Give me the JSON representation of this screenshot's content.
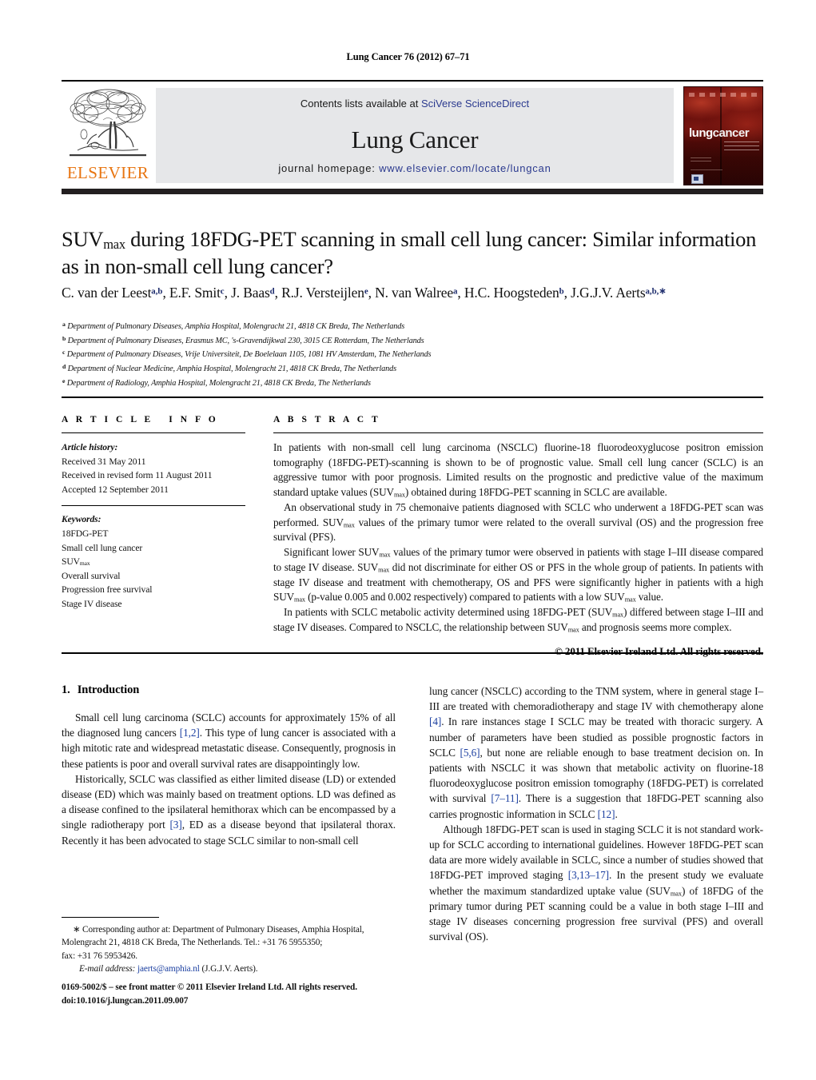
{
  "running_head": "Lung Cancer 76 (2012) 67–71",
  "masthead": {
    "contents_prefix": "Contents lists available at ",
    "contents_link": "SciVerse ScienceDirect",
    "journal_title": "Lung Cancer",
    "homepage_prefix": "journal homepage: ",
    "homepage_url": "www.elsevier.com/locate/lungcan",
    "publisher_wordmark": "ELSEVIER",
    "cover_title_part1": "lung",
    "cover_title_part2": "cancer",
    "link_color": "#2B3A8F",
    "banner_bg": "#E6E7E9",
    "elsevier_orange": "#E87511"
  },
  "title": {
    "line1_pre": "SUV",
    "line1_sub": "max",
    "line1_post": " during 18FDG-PET scanning in small cell lung cancer: Similar information",
    "line2": "as in non-small cell lung cancer?"
  },
  "authors": [
    {
      "name": "C. van der Leest",
      "sup": "a,b",
      "sep": ", "
    },
    {
      "name": "E.F. Smit",
      "sup": "c",
      "sep": ", "
    },
    {
      "name": "J. Baas",
      "sup": "d",
      "sep": ", "
    },
    {
      "name": "R.J. Versteijlen",
      "sup": "e",
      "sep": ", "
    },
    {
      "name": "N. van Walree",
      "sup": "a",
      "sep": ", "
    },
    {
      "name": "H.C. Hoogsteden",
      "sup": "b",
      "sep": ", "
    },
    {
      "name": "J.G.J.V. Aerts",
      "sup": "a,b,∗",
      "sep": ""
    }
  ],
  "affiliations": [
    {
      "marker": "a",
      "text": "Department of Pulmonary Diseases, Amphia Hospital, Molengracht 21, 4818 CK Breda, The Netherlands"
    },
    {
      "marker": "b",
      "text": "Department of Pulmonary Diseases, Erasmus MC, 's-Gravendijkwal 230, 3015 CE Rotterdam, The Netherlands"
    },
    {
      "marker": "c",
      "text": "Department of Pulmonary Diseases, Vrije Universiteit, De Boelelaan 1105, 1081 HV Amsterdam, The Netherlands"
    },
    {
      "marker": "d",
      "text": "Department of Nuclear Medicine, Amphia Hospital, Molengracht 21, 4818 CK Breda, The Netherlands"
    },
    {
      "marker": "e",
      "text": "Department of Radiology, Amphia Hospital, Molengracht 21, 4818 CK Breda, The Netherlands"
    }
  ],
  "article_info": {
    "heading": "ARTICLE INFO",
    "history_label": "Article history:",
    "history": [
      "Received 31 May 2011",
      "Received in revised form 11 August 2011",
      "Accepted 12 September 2011"
    ],
    "keywords_label": "Keywords:",
    "keywords": [
      "18FDG-PET",
      "Small cell lung cancer",
      "SUVmax",
      "Overall survival",
      "Progression free survival",
      "Stage IV disease"
    ]
  },
  "abstract": {
    "heading": "ABSTRACT",
    "paragraphs": [
      "In patients with non-small cell lung carcinoma (NSCLC) fluorine-18 fluorodeoxyglucose positron emission tomography (18FDG-PET)-scanning is shown to be of prognostic value. Small cell lung cancer (SCLC) is an aggressive tumor with poor prognosis. Limited results on the prognostic and predictive value of the maximum standard uptake values (SUVmax) obtained during 18FDG-PET scanning in SCLC are available.",
      "An observational study in 75 chemonaive patients diagnosed with SCLC who underwent a 18FDG-PET scan was performed. SUVmax values of the primary tumor were related to the overall survival (OS) and the progression free survival (PFS).",
      "Significant lower SUVmax values of the primary tumor were observed in patients with stage I–III disease compared to stage IV disease. SUVmax did not discriminate for either OS or PFS in the whole group of patients. In patients with stage IV disease and treatment with chemotherapy, OS and PFS were significantly higher in patients with a high SUVmax (p-value 0.005 and 0.002 respectively) compared to patients with a low SUVmax value.",
      "In patients with SCLC metabolic activity determined using 18FDG-PET (SUVmax) differed between stage I–III and stage IV diseases. Compared to NSCLC, the relationship between SUVmax and prognosis seems more complex."
    ],
    "copyright": "© 2011 Elsevier Ireland Ltd. All rights reserved."
  },
  "body": {
    "section_number": "1.",
    "section_title": "Introduction",
    "left_paragraphs": [
      "Small cell lung carcinoma (SCLC) accounts for approximately 15% of all the diagnosed lung cancers [1,2]. This type of lung cancer is associated with a high mitotic rate and widespread metastatic disease. Consequently, prognosis in these patients is poor and overall survival rates are disappointingly low.",
      "Historically, SCLC was classified as either limited disease (LD) or extended disease (ED) which was mainly based on treatment options. LD was defined as a disease confined to the ipsilateral hemithorax which can be encompassed by a single radiotherapy port [3], ED as a disease beyond that ipsilateral thorax. Recently it has been advocated to stage SCLC similar to non-small cell"
    ],
    "right_paragraphs": [
      "lung cancer (NSCLC) according to the TNM system, where in general stage I–III are treated with chemoradiotherapy and stage IV with chemotherapy alone [4]. In rare instances stage I SCLC may be treated with thoracic surgery. A number of parameters have been studied as possible prognostic factors in SCLC [5,6], but none are reliable enough to base treatment decision on. In patients with NSCLC it was shown that metabolic activity on fluorine-18 fluorodeoxyglucose positron emission tomography (18FDG-PET) is correlated with survival [7–11]. There is a suggestion that 18FDG-PET scanning also carries prognostic information in SCLC [12].",
      "Although 18FDG-PET scan is used in staging SCLC it is not standard work-up for SCLC according to international guidelines. However 18FDG-PET scan data are more widely available in SCLC, since a number of studies showed that 18FDG-PET improved staging [3,13–17]. In the present study we evaluate whether the maximum standardized uptake value (SUVmax) of 18FDG of the primary tumor during PET scanning could be a value in both stage I–III and stage IV diseases concerning progression free survival (PFS) and overall survival (OS)."
    ]
  },
  "footnote": {
    "corresponding_line1": "∗ Corresponding author at: Department of Pulmonary Diseases, Amphia Hospital,",
    "corresponding_line2": "Molengracht 21, 4818 CK Breda, The Netherlands. Tel.: +31 76 5955350;",
    "corresponding_line3": "fax: +31 76 5953426.",
    "email_label": "E-mail address:",
    "email": "jaerts@amphia.nl",
    "email_owner": "(J.G.J.V. Aerts)."
  },
  "issn": {
    "line1": "0169-5002/$ – see front matter © 2011 Elsevier Ireland Ltd. All rights reserved.",
    "line2": "doi:10.1016/j.lungcan.2011.09.007"
  }
}
